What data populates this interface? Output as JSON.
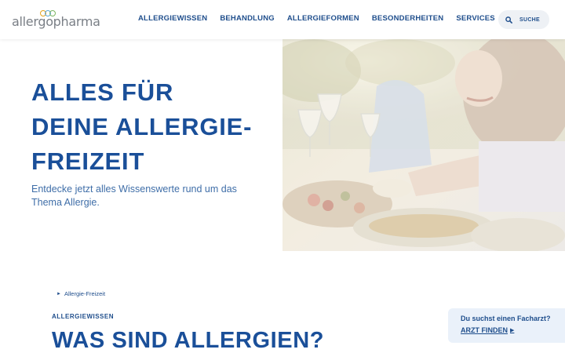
{
  "brand": {
    "logo_text": "allergopharma",
    "ring_colors": [
      "#e3a21a",
      "#5aa6d6",
      "#7bb661"
    ]
  },
  "nav": {
    "items": [
      "ALLERGIEWISSEN",
      "BEHANDLUNG",
      "ALLERGIEFORMEN",
      "BESONDERHEITEN",
      "SERVICES"
    ]
  },
  "search": {
    "label": "SUCHE",
    "icon": "search-icon"
  },
  "hero": {
    "title_lines": [
      "ALLES FÜR",
      "DEINE ALLERGIE-",
      "FREIZEIT"
    ],
    "subtitle": "Entdecke jetzt alles Wissenswerte rund um das Thema Allergie.",
    "image": "people-eating-outdoors-photo"
  },
  "breadcrumb": {
    "current": "Allergie-Freizeit"
  },
  "section": {
    "eyebrow": "ALLERGIEWISSEN",
    "title": "WAS SIND ALLERGIEN?"
  },
  "doctor_finder": {
    "question": "Du suchst einen Facharzt?",
    "link": "ARZT FINDEN"
  },
  "colors": {
    "primary": "#1a4f99",
    "text_secondary": "#3f6ea8",
    "panel_bg": "#eaf1fa"
  }
}
